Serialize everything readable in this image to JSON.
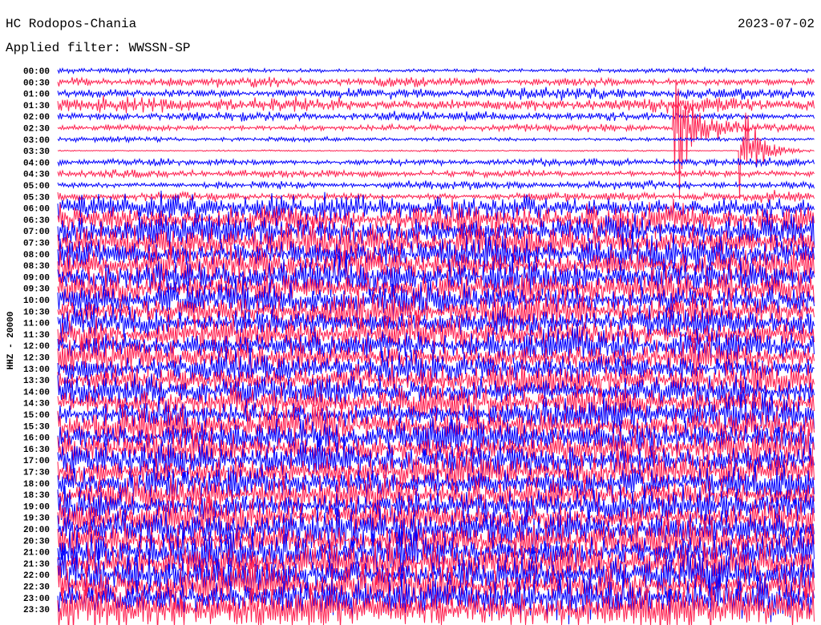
{
  "header": {
    "station": "HC Rodopos-Chania",
    "filter": "Applied filter: WWSSN-SP",
    "date": "2023-07-02"
  },
  "chart_data": {
    "type": "line",
    "title": "HC Rodopos-Chania",
    "subtitle": "Applied filter: WWSSN-SP",
    "ylabel": "HHZ - 20000",
    "xlabel": "",
    "minutes_per_row": 30,
    "row_labels": [
      "00:00",
      "00:30",
      "01:00",
      "01:30",
      "02:00",
      "02:30",
      "03:00",
      "03:30",
      "04:00",
      "04:30",
      "05:00",
      "05:30",
      "06:00",
      "06:30",
      "07:00",
      "07:30",
      "08:00",
      "08:30",
      "09:00",
      "09:30",
      "10:00",
      "10:30",
      "11:00",
      "11:30",
      "12:00",
      "12:30",
      "13:00",
      "13:30",
      "14:00",
      "14:30",
      "15:00",
      "15:30",
      "16:00",
      "16:30",
      "17:00",
      "17:30",
      "18:00",
      "18:30",
      "19:00",
      "19:30",
      "20:00",
      "20:30",
      "21:00",
      "21:30",
      "22:00",
      "22:30",
      "23:00",
      "23:30"
    ],
    "series_colors": [
      "#0000ff",
      "#ff1f4f"
    ],
    "relative_amplitude": [
      3,
      6,
      7,
      10,
      6,
      5,
      3,
      1,
      5,
      5,
      5,
      6,
      18,
      22,
      22,
      24,
      24,
      24,
      24,
      24,
      24,
      24,
      20,
      22,
      22,
      22,
      20,
      22,
      22,
      22,
      22,
      24,
      24,
      24,
      24,
      24,
      24,
      24,
      24,
      24,
      26,
      26,
      28,
      28,
      28,
      28,
      30,
      30
    ],
    "events": [
      {
        "row": "02:30",
        "minute": 24.4,
        "relative_amplitude": 160
      },
      {
        "row": "03:30",
        "minute": 27.0,
        "relative_amplitude": 110
      }
    ]
  }
}
